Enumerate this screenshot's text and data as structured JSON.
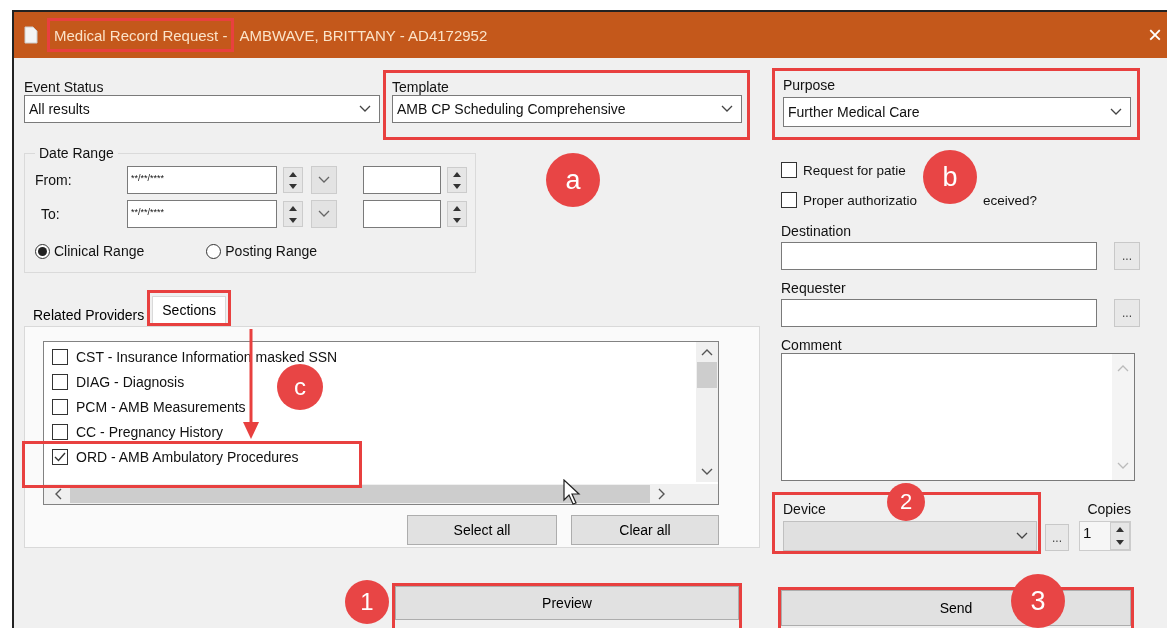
{
  "window": {
    "title": "Medical Record Request -",
    "subtitle": "AMBWAVE, BRITTANY - AD4172952",
    "close": "×"
  },
  "event_status": {
    "label": "Event Status",
    "value": "All results"
  },
  "template": {
    "label": "Template",
    "value": "AMB CP Scheduling Comprehensive"
  },
  "purpose": {
    "label": "Purpose",
    "value": "Further Medical Care"
  },
  "date_range": {
    "title": "Date Range",
    "rows": [
      {
        "label": "From:",
        "value": "**/**/****"
      },
      {
        "label": "To:",
        "value": "**/**/****"
      }
    ],
    "options": [
      {
        "label": "Clinical Range",
        "selected": true
      },
      {
        "label": "Posting Range",
        "selected": false
      }
    ]
  },
  "checkboxes": [
    {
      "parts": [
        "Request for patie"
      ],
      "checked": false
    },
    {
      "parts": [
        "Proper authorizatio",
        "eceived?"
      ],
      "checked": false
    }
  ],
  "destination": {
    "label": "Destination",
    "button": "..."
  },
  "requester": {
    "label": "Requester",
    "button": "..."
  },
  "comment": {
    "label": "Comment"
  },
  "tabs": [
    {
      "label": "Related Providers",
      "selected": false
    },
    {
      "label": "Sections",
      "selected": true
    }
  ],
  "sections": [
    {
      "label": "CST - Insurance Information masked SSN",
      "checked": false
    },
    {
      "label": "DIAG - Diagnosis",
      "checked": false
    },
    {
      "label": "PCM - AMB Measurements",
      "checked": false
    },
    {
      "label": "CC - Pregnancy History",
      "checked": false
    },
    {
      "label": "ORD - AMB Ambulatory Procedures",
      "checked": true
    }
  ],
  "select_all": "Select all",
  "clear_all": "Clear all",
  "device": {
    "label": "Device",
    "disabled": true,
    "button": "..."
  },
  "copies": {
    "label": "Copies",
    "value": "1"
  },
  "preview": "Preview",
  "send": "Send",
  "markers": [
    "a",
    "b",
    "c",
    "1",
    "2",
    "3"
  ]
}
